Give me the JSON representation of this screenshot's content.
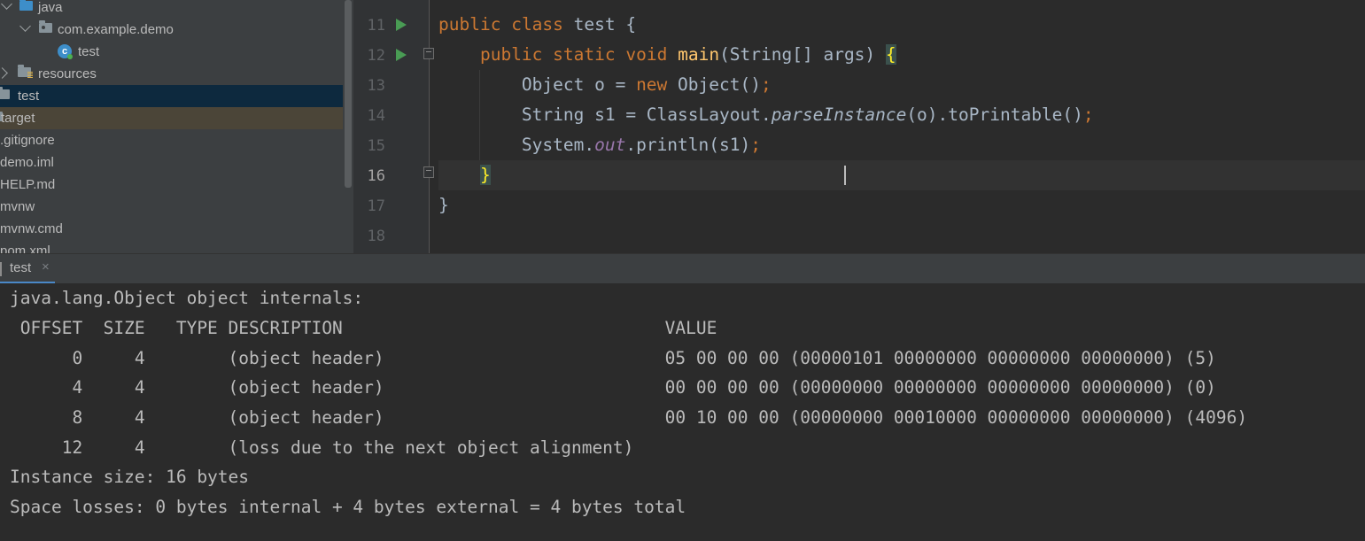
{
  "project_tree": {
    "items": [
      {
        "label": "java",
        "icon": "folder-blue-icon",
        "arrow": "down"
      },
      {
        "label": "com.example.demo",
        "icon": "package-icon",
        "arrow": "down"
      },
      {
        "label": "test",
        "icon": "java-class-icon",
        "glyph": "c"
      },
      {
        "label": "resources",
        "icon": "resources-folder-icon",
        "arrow": "right"
      },
      {
        "label": "test",
        "icon": "folder-icon"
      },
      {
        "label": "target",
        "icon": "folder-icon"
      },
      {
        "label": ".gitignore"
      },
      {
        "label": "demo.iml"
      },
      {
        "label": "HELP.md"
      },
      {
        "label": "mvnw"
      },
      {
        "label": "mvnw.cmd"
      },
      {
        "label": "pom.xml"
      }
    ]
  },
  "editor": {
    "line_numbers": [
      "11",
      "12",
      "13",
      "14",
      "15",
      "16",
      "17",
      "18"
    ],
    "active_line": "16",
    "code": {
      "l11": {
        "kw1": "public",
        "kw2": "class",
        "name": "test {"
      },
      "l12": {
        "kw1": "public",
        "kw2": "static",
        "kw3": "void",
        "method": "main",
        "params": "(String[] args) ",
        "brace": "{"
      },
      "l13": {
        "a": "Object o = ",
        "kw": "new",
        "b": " Object()",
        "semi": ";"
      },
      "l14": {
        "a": "String s1 = ClassLayout.",
        "static_method": "parseInstance",
        "b": "(o).toPrintable()",
        "semi": ";"
      },
      "l15": {
        "a": "System.",
        "field": "out",
        "b": ".println(s1)",
        "semi": ";"
      },
      "l16": {
        "brace": "}"
      },
      "l17": {
        "text": "}"
      }
    }
  },
  "console": {
    "tab_label": "test",
    "lines": [
      "java.lang.Object object internals:",
      " OFFSET  SIZE   TYPE DESCRIPTION                               VALUE",
      "      0     4        (object header)                           05 00 00 00 (00000101 00000000 00000000 00000000) (5)",
      "      4     4        (object header)                           00 00 00 00 (00000000 00000000 00000000 00000000) (0)",
      "      8     4        (object header)                           00 10 00 00 (00000000 00010000 00000000 00000000) (4096)",
      "     12     4        (loss due to the next object alignment)",
      "Instance size: 16 bytes",
      "Space losses: 0 bytes internal + 4 bytes external = 4 bytes total"
    ]
  },
  "colors": {
    "background": "#2b2b2b",
    "keyword": "#cc7832",
    "method": "#ffc66d",
    "field": "#9876aa",
    "text": "#a9b7c6",
    "selection": "#0d293e"
  }
}
